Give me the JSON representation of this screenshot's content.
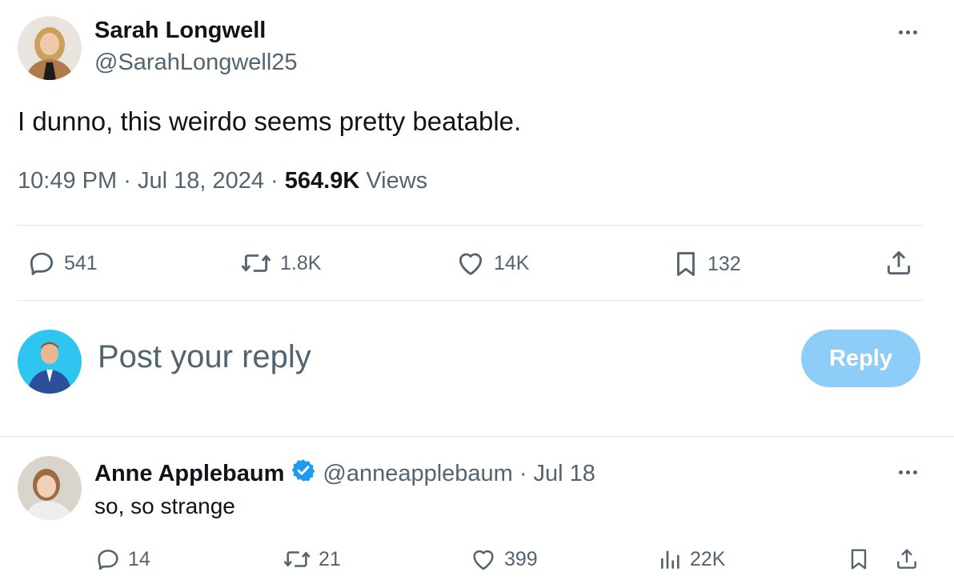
{
  "tweet": {
    "author_name": "Sarah Longwell",
    "author_handle": "@SarahLongwell25",
    "text": "I dunno, this weirdo seems pretty beatable.",
    "time": "10:49 PM",
    "date": "Jul 18, 2024",
    "separator": "·",
    "views_count": "564.9K",
    "views_label": "Views",
    "stats": {
      "replies": "541",
      "reposts": "1.8K",
      "likes": "14K",
      "bookmarks": "132"
    }
  },
  "composer": {
    "placeholder": "Post your reply",
    "button_label": "Reply"
  },
  "reply": {
    "author_name": "Anne Applebaum",
    "author_handle": "@anneapplebaum",
    "separator": "·",
    "date": "Jul 18",
    "text": "so, so strange",
    "stats": {
      "replies": "14",
      "reposts": "21",
      "likes": "399",
      "views": "22K"
    }
  },
  "colors": {
    "text_primary": "#0f1419",
    "text_secondary": "#536471",
    "reply_button": "#8ecdf7",
    "verified_badge": "#1d9bf0",
    "divider": "#e6e9eb"
  },
  "icons": [
    "more-icon",
    "comment-icon",
    "repost-icon",
    "heart-icon",
    "bookmark-icon",
    "share-icon",
    "analytics-icon",
    "verified-badge-icon"
  ]
}
